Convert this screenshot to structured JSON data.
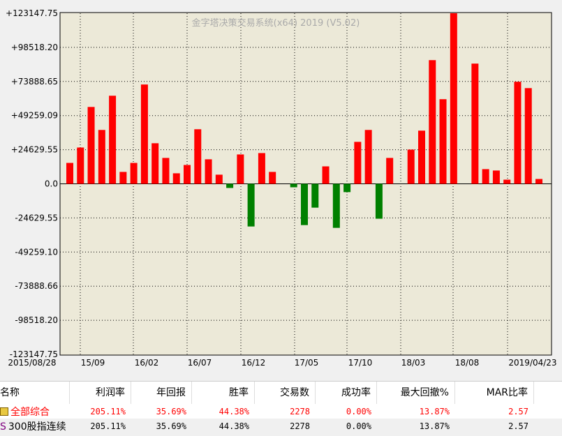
{
  "chart_data": {
    "type": "bar",
    "title": "金字塔决策交易系统(x64) 2019 (V5.02)",
    "y_ticks": [
      "+123147.75",
      "+98518.20",
      "+73888.65",
      "+49259.09",
      "+24629.55",
      "0.0",
      "-24629.55",
      "-49259.10",
      "-73888.66",
      "-98518.20",
      "-123147.75"
    ],
    "ylim": [
      -123147.75,
      123147.75
    ],
    "x_ticks": [
      "2015/08/28",
      "15/09",
      "16/02",
      "16/07",
      "16/12",
      "17/05",
      "17/10",
      "18/03",
      "18/08",
      "2019/04/23"
    ],
    "values": [
      15100,
      26200,
      55500,
      38900,
      63600,
      8600,
      15100,
      71700,
      29300,
      18700,
      7600,
      13600,
      39400,
      17700,
      6600,
      -3000,
      21200,
      -30800,
      22200,
      8600,
      0,
      -2500,
      -29800,
      -17200,
      12600,
      -31800,
      -6000,
      30300,
      38900,
      -25200,
      18700,
      0,
      24700,
      38400,
      89300,
      61100,
      123147,
      0,
      86800,
      10600,
      9600,
      3000,
      73700,
      69100,
      3500
    ],
    "colors": {
      "positive": "#ff0000",
      "negative": "#008000",
      "background": "#ece9d8"
    }
  },
  "table": {
    "headers": [
      "名称",
      "利润率",
      "年回报",
      "胜率",
      "交易数",
      "成功率",
      "最大回撤%",
      "MAR比率"
    ],
    "rows": [
      {
        "name": "全部综合",
        "icon": "folder-icon",
        "cells": [
          "205.11%",
          "35.69%",
          "44.38%",
          "2278",
          "0.00%",
          "13.87%",
          "2.57"
        ]
      },
      {
        "name": "300股指连续",
        "icon": "S",
        "cells": [
          "205.11%",
          "35.69%",
          "44.38%",
          "2278",
          "0.00%",
          "13.87%",
          "2.57"
        ]
      }
    ]
  }
}
